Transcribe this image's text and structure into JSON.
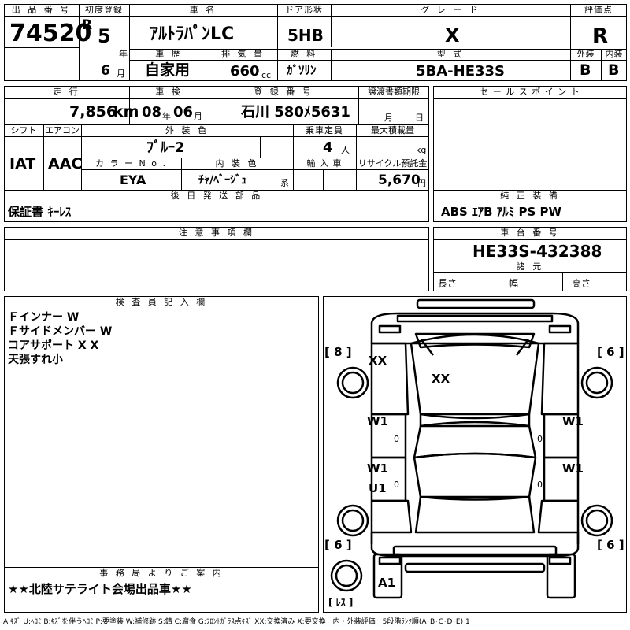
{
  "labels": {
    "lot_no": "出 品 番 号",
    "first_reg": "初度登録",
    "car_name": "車 名",
    "door": "ドア形状",
    "grade": "グ レ ー ド",
    "score": "評価点",
    "year_unit": "年",
    "month_unit": "月",
    "history": "車 歴",
    "displacement": "排 気 量",
    "fuel": "燃 料",
    "model": "型 式",
    "exterior": "外装",
    "interior": "内装",
    "mileage": "走 行",
    "inspection": "車 検",
    "reg_no": "登 録 番 号",
    "transfer": "譲渡書類期限",
    "sales_point": "セ ー ル ス ポ イ ン ト",
    "shift": "シフト",
    "aircon": "エアコン",
    "ext_color": "外 装 色",
    "capacity": "乗車定員",
    "max_load": "最大積載量",
    "color_no": "カ ラ ー N o .",
    "int_color": "内 装 色",
    "import": "輸 入 車",
    "recycle": "リサイクル預託金",
    "later_parts": "後 日 発 送 部 品",
    "equipment": "純 正 装 備",
    "caution": "注 意 事 項 欄",
    "chassis": "車 台 番 号",
    "specs": "諸 元",
    "length": "長さ",
    "width": "幅",
    "height": "高さ",
    "inspector": "検 査 員 記 入 欄",
    "office": "事 務 局 よ り ご 案 内",
    "km": "km",
    "cc": "cc",
    "person": "人",
    "kg": "kg",
    "yen": "円",
    "kei": "系",
    "insp_year": "年",
    "insp_month": "月",
    "transfer_month": "月",
    "transfer_day": "日"
  },
  "values": {
    "lot_no": "74520",
    "era": "R",
    "reg_year": "5",
    "reg_month": "6",
    "car_name": "ｱﾙﾄﾗﾊﾟﾝLC",
    "door": "5HB",
    "grade": "X",
    "score": "R",
    "history": "自家用",
    "displacement": "660",
    "fuel": "ｶﾞｿﾘﾝ",
    "model": "5BA-HE33S",
    "exterior": "B",
    "interior": "B",
    "mileage": "7,856",
    "insp_year": "08",
    "insp_month": "06",
    "reg_no": "石川 580ﾒ5631",
    "shift": "IAT",
    "aircon": "AAC",
    "ext_color": "ﾌﾞﾙｰ2",
    "capacity": "4",
    "color_no": "EYA",
    "int_color": "ﾁｬ/ﾍﾞｰｼﾞｭ",
    "recycle": "5,670",
    "later_parts": "保証書 ｷｰﾚｽ",
    "equipment": "ABS ｴｱB ｱﾙﾐ PS PW",
    "chassis": "HE33S-432388",
    "inspector_notes": [
      "Ｆインナー W",
      "Ｆサイドメンバー W",
      "コアサポート X X",
      "天張すれ小"
    ],
    "office_note": "★★北陸サテライト会場出品車★★"
  },
  "diagram": {
    "tags": {
      "left_top": "[ 8 ]",
      "right_top": "[ 6 ]",
      "left_bottom": "[ 6 ]",
      "right_bottom": "[ 6 ]",
      "bottom": "[ ﾚｽ ]"
    },
    "marks": {
      "xx_left": "XX",
      "xx_center": "XX",
      "w1_lf": "W1",
      "w1_rf": "W1",
      "w1_lr": "W1",
      "w1_rr": "W1",
      "u1": "U1",
      "a1": "A1",
      "zero_l1": "0",
      "zero_r1": "0",
      "zero_l2": "0",
      "zero_r2": "0"
    }
  },
  "legend": "A:ｷｽﾞ U:ﾍｺﾐ B:ｷｽﾞを伴うﾍｺﾐ P:要塗装 W:補修跡 S:錆 C:腐食 G:ﾌﾛﾝﾄｶﾞﾗｽ点ｷｽﾞ XX:交換済み X:要交換　内・外装評価　5段階ﾗﾝｸ順(A･B･C･D･E) 1"
}
